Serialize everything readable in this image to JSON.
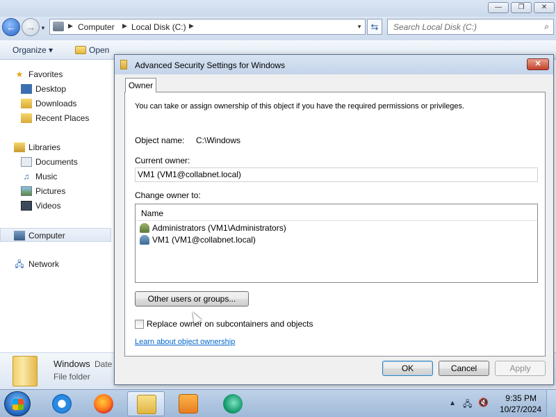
{
  "explorer": {
    "address": {
      "crumbs": [
        "Computer",
        "Local Disk (C:)"
      ],
      "search_placeholder": "Search Local Disk (C:)"
    },
    "toolbar": {
      "organize": "Organize ▾",
      "open": "Open"
    },
    "nav": {
      "favorites": "Favorites",
      "desktop": "Desktop",
      "downloads": "Downloads",
      "recent_places": "Recent Places",
      "libraries": "Libraries",
      "documents": "Documents",
      "music": "Music",
      "pictures": "Pictures",
      "videos": "Videos",
      "computer": "Computer",
      "network": "Network"
    },
    "details": {
      "name": "Windows",
      "date_label": "Date",
      "type": "File folder"
    }
  },
  "dialog": {
    "title": "Advanced Security Settings for Windows",
    "close": "✕",
    "tab": "Owner",
    "description": "You can take or assign ownership of this object if you have the required permissions or privileges.",
    "object_name_label": "Object name:",
    "object_name_value": "C:\\Windows",
    "current_owner_label": "Current owner:",
    "current_owner_value": "VM1 (VM1@collabnet.local)",
    "change_owner_label": "Change owner to:",
    "list_header": "Name",
    "owners": [
      "Administrators (VM1\\Administrators)",
      "VM1 (VM1@collabnet.local)"
    ],
    "other_users_button": "Other users or groups...",
    "replace_owner_label": "Replace owner on subcontainers and objects",
    "replace_owner_checked": false,
    "learn_link": "Learn about object ownership",
    "ok": "OK",
    "cancel": "Cancel",
    "apply": "Apply"
  },
  "taskbar": {
    "time": "9:35 PM",
    "date": "10/27/2024",
    "tray_up": "▴"
  }
}
